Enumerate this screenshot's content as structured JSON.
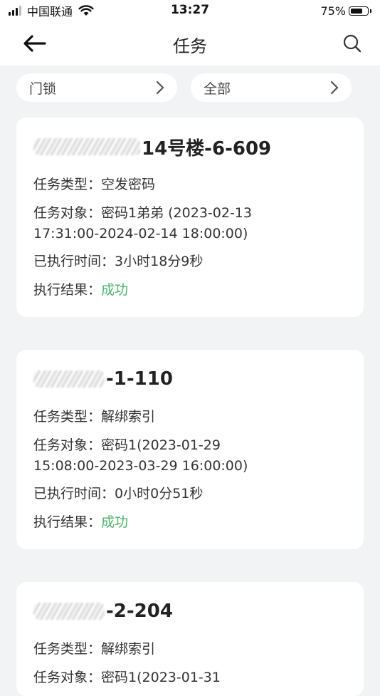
{
  "status_bar": {
    "carrier": "中国联通",
    "time": "13:27",
    "battery_percent": "75%",
    "battery_level": 0.75
  },
  "nav": {
    "title": "任务"
  },
  "filters": {
    "device": "门锁",
    "status": "全部"
  },
  "labels": {
    "task_type": "任务类型：",
    "task_target": "任务对象：",
    "elapsed": "已执行时间：",
    "result": "执行结果："
  },
  "tasks": [
    {
      "title_suffix": "14号楼-6-609",
      "type": "空发密码",
      "target_line1": "密码1弟弟 (2023-02-13",
      "target_line2": "17:31:00-2024-02-14 18:00:00)",
      "elapsed": "3小时18分9秒",
      "result": "成功"
    },
    {
      "title_suffix": "-1-110",
      "type": "解绑索引",
      "target_line1": "密码1(2023-01-29",
      "target_line2": "15:08:00-2023-03-29 16:00:00)",
      "elapsed": "0小时0分51秒",
      "result": "成功"
    },
    {
      "title_suffix": "-2-204",
      "type": "解绑索引",
      "target_line1": "密码1(2023-01-31"
    }
  ],
  "colors": {
    "success": "#4cb36a",
    "background": "#f2f3f5",
    "card": "#ffffff"
  }
}
